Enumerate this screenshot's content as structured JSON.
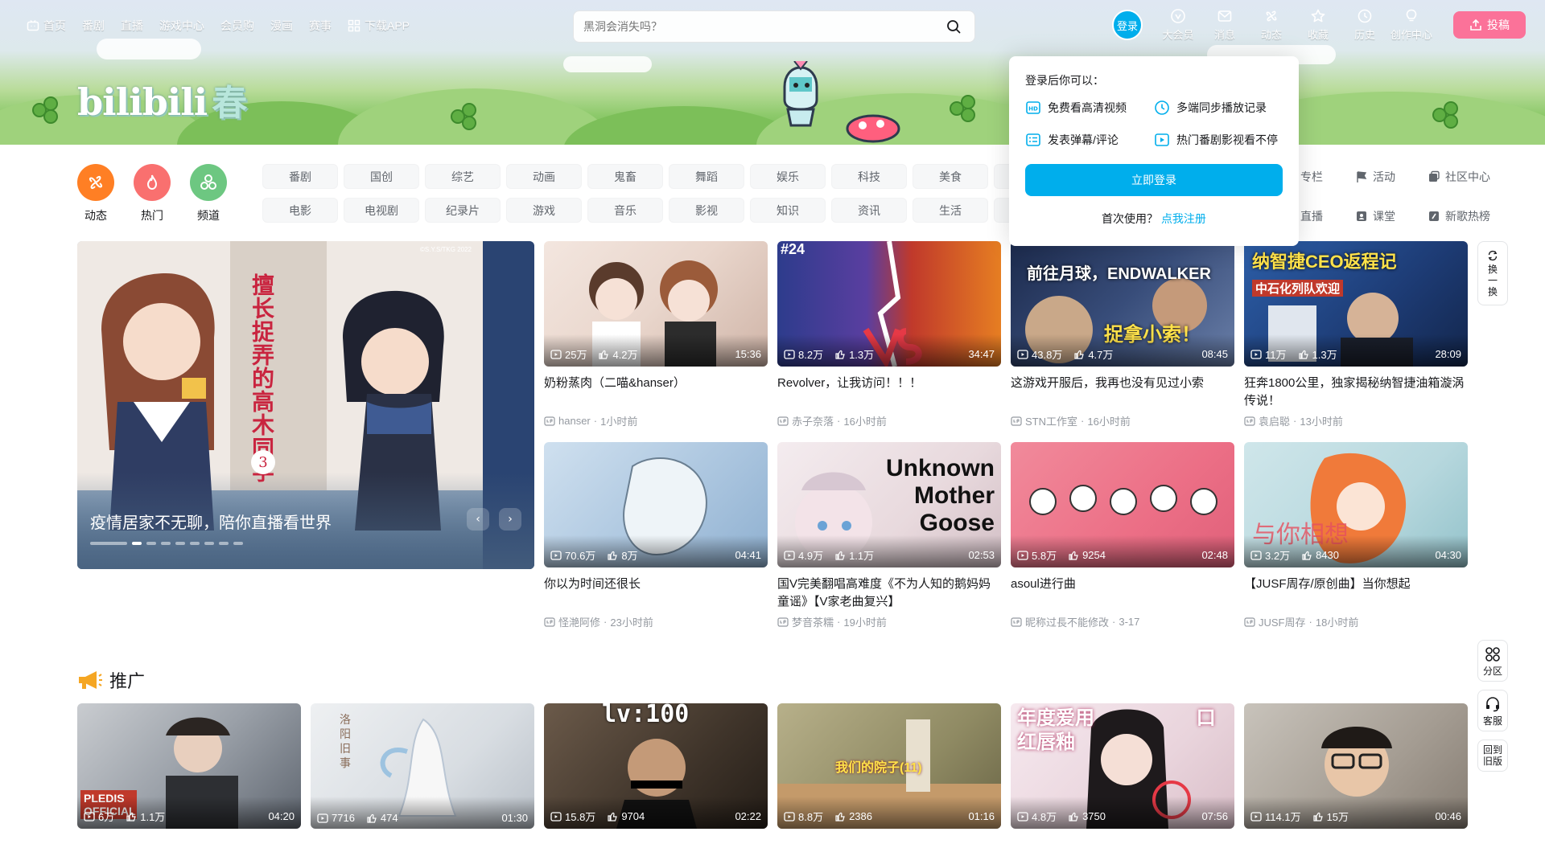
{
  "nav": {
    "items": [
      {
        "label": "首页"
      },
      {
        "label": "番剧"
      },
      {
        "label": "直播"
      },
      {
        "label": "游戏中心"
      },
      {
        "label": "会员购"
      },
      {
        "label": "漫画"
      },
      {
        "label": "赛事"
      },
      {
        "label": "下载APP"
      }
    ]
  },
  "search": {
    "placeholder": "黑洞会消失吗？"
  },
  "user": {
    "login_label": "登录",
    "icons": [
      {
        "label": "大会员",
        "icon": "vip-icon"
      },
      {
        "label": "消息",
        "icon": "message-icon"
      },
      {
        "label": "动态",
        "icon": "dynamic-icon"
      },
      {
        "label": "收藏",
        "icon": "favorite-icon"
      },
      {
        "label": "历史",
        "icon": "history-icon"
      },
      {
        "label": "创作中心",
        "icon": "creator-icon"
      }
    ],
    "upload_label": "投稿"
  },
  "logo": {
    "text": "bilibili",
    "sub": "春"
  },
  "channels": {
    "icons": [
      {
        "label": "动态",
        "color": "#ff7f24"
      },
      {
        "label": "热门",
        "color": "#f9706f"
      },
      {
        "label": "频道",
        "color": "#6dc781"
      }
    ],
    "tags": [
      "番剧",
      "国创",
      "综艺",
      "动画",
      "鬼畜",
      "舞蹈",
      "娱乐",
      "科技",
      "美食",
      "",
      "电影",
      "电视剧",
      "纪录片",
      "游戏",
      "音乐",
      "影视",
      "知识",
      "资讯",
      "生活",
      ""
    ],
    "extra": [
      {
        "label": "专栏"
      },
      {
        "label": "活动"
      },
      {
        "label": "社区中心"
      },
      {
        "label": "直播"
      },
      {
        "label": "课堂"
      },
      {
        "label": "新歌热榜"
      }
    ]
  },
  "carousel": {
    "title": "疫情居家不无聊，陪你直播看世界",
    "badge": "©S.Y.S/TKG 2022",
    "vertical_text": "擅长捉弄的高木同学",
    "season": "3"
  },
  "videos": [
    {
      "title": "奶粉蒸肉（二喵&hanser）",
      "views": "25万",
      "likes": "4.2万",
      "duration": "15:36",
      "author": "hanser",
      "time": "1小时前"
    },
    {
      "title": "Revolver，让我访问！！！",
      "views": "8.2万",
      "likes": "1.3万",
      "duration": "34:47",
      "author": "赤子奈落",
      "time": "16小时前"
    },
    {
      "title": "这游戏开服后，我再也没有见过小索",
      "views": "43.8万",
      "likes": "4.7万",
      "duration": "08:45",
      "author": "STN工作室",
      "time": "16小时前"
    },
    {
      "title": "狂奔1800公里，独家揭秘纳智捷油箱漩涡传说！",
      "views": "11万",
      "likes": "1.3万",
      "duration": "28:09",
      "author": "袁启聪",
      "time": "13小时前"
    },
    {
      "title": "你以为时间还很长",
      "views": "70.6万",
      "likes": "8万",
      "duration": "04:41",
      "author": "怪滟阿修",
      "time": "23小时前"
    },
    {
      "title": "国V完美翻唱高难度《不为人知的鹅妈妈童谣》【V家老曲复兴】",
      "views": "4.9万",
      "likes": "1.1万",
      "duration": "02:53",
      "author": "梦音茶糯",
      "time": "19小时前"
    },
    {
      "title": "asoul进行曲",
      "views": "5.8万",
      "likes": "9254",
      "duration": "02:48",
      "author": "昵称过長不能修改",
      "time": "3-17"
    },
    {
      "title": "【JUSF周存/原创曲】当你想起",
      "views": "3.2万",
      "likes": "8430",
      "duration": "04:30",
      "author": "JUSF周存",
      "time": "18小时前"
    }
  ],
  "thumb_text": {
    "v1": "#24",
    "v2": "前往月球，ENDWALKER",
    "v2b": "捉拿小索！",
    "v3": "纳智捷CEO返程记",
    "v3b": "中石化列队欢迎",
    "v5": "Unknown Mother Goose",
    "v7": "与你相想"
  },
  "refresh_label": "换一换",
  "promo": {
    "title": "推广",
    "videos": [
      {
        "views": "6万",
        "likes": "1.1万",
        "duration": "04:20",
        "thumb": "PLEDIS OFFICIAL"
      },
      {
        "views": "7716",
        "likes": "474",
        "duration": "01:30",
        "thumb": "洛阳旧事"
      },
      {
        "views": "15.8万",
        "likes": "9704",
        "duration": "02:22",
        "thumb": "lv:100"
      },
      {
        "views": "8.8万",
        "likes": "2386",
        "duration": "01:16",
        "thumb": "我们的院子(11)"
      },
      {
        "views": "4.8万",
        "likes": "3750",
        "duration": "07:56",
        "thumb": "年度爱用 口红唇釉"
      },
      {
        "views": "114.1万",
        "likes": "15万",
        "duration": "00:46",
        "thumb": ""
      }
    ]
  },
  "side_tools": [
    {
      "label": "分区"
    },
    {
      "label": "客服"
    },
    {
      "label": "回到旧版"
    }
  ],
  "login_popup": {
    "title": "登录后你可以：",
    "features": [
      {
        "label": "免费看高清视频",
        "icon": "hd-icon"
      },
      {
        "label": "多端同步播放记录",
        "icon": "sync-icon"
      },
      {
        "label": "发表弹幕/评论",
        "icon": "comment-icon"
      },
      {
        "label": "热门番剧影视看不停",
        "icon": "play-icon"
      }
    ],
    "button": "立即登录",
    "first_use": "首次使用？",
    "register": "点我注册"
  }
}
